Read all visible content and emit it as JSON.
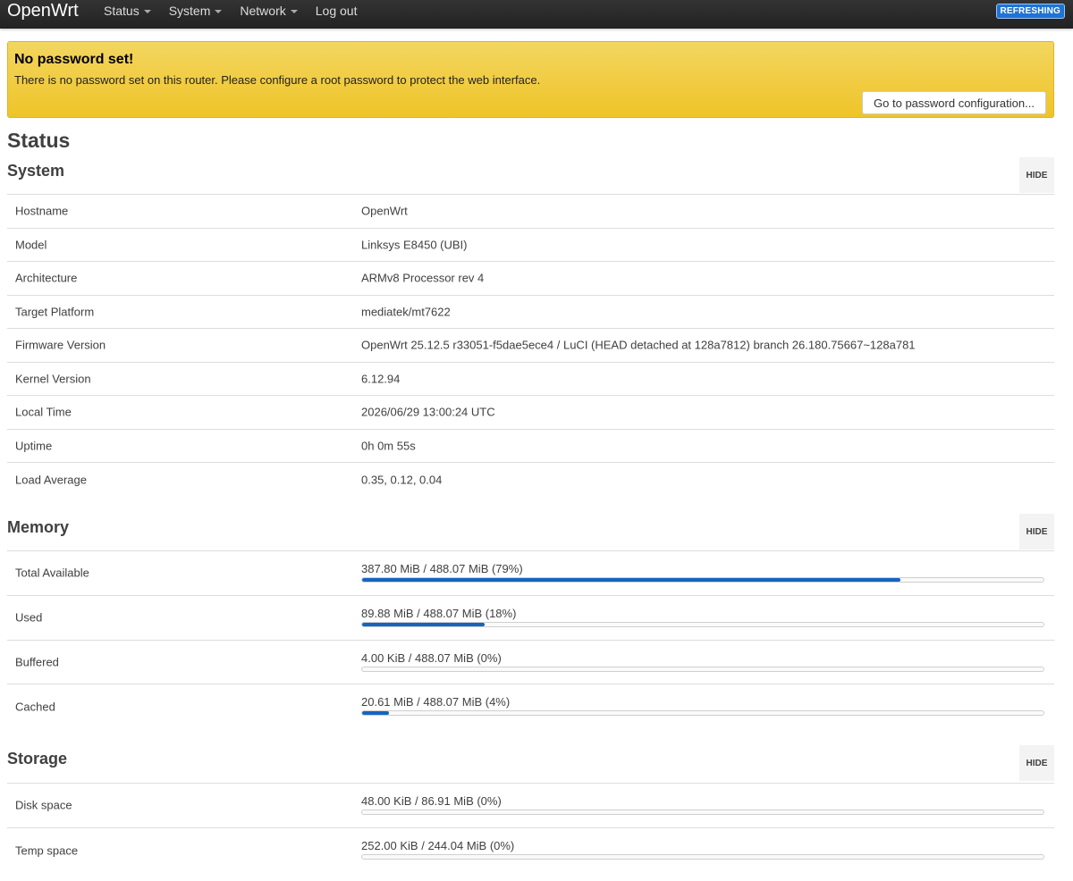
{
  "nav": {
    "brand": "OpenWrt",
    "menus": [
      "Status",
      "System",
      "Network"
    ],
    "logout": "Log out",
    "indicator": "REFRESHING"
  },
  "alert": {
    "title": "No password set!",
    "text": "There is no password set on this router. Please configure a root password to protect the web interface.",
    "button": "Go to password configuration..."
  },
  "page_title": "Status",
  "hide_label": "HIDE",
  "system": {
    "title": "System",
    "rows": [
      {
        "key": "Hostname",
        "value": "OpenWrt"
      },
      {
        "key": "Model",
        "value": "Linksys E8450 (UBI)"
      },
      {
        "key": "Architecture",
        "value": "ARMv8 Processor rev 4"
      },
      {
        "key": "Target Platform",
        "value": "mediatek/mt7622"
      },
      {
        "key": "Firmware Version",
        "value": "OpenWrt 25.12.5 r33051-f5dae5ece4 / LuCI (HEAD detached at 128a7812) branch 26.180.75667~128a781"
      },
      {
        "key": "Kernel Version",
        "value": "6.12.94"
      },
      {
        "key": "Local Time",
        "value": "2026/06/29 13:00:24 UTC"
      },
      {
        "key": "Uptime",
        "value": "0h 0m 55s"
      },
      {
        "key": "Load Average",
        "value": "0.35, 0.12, 0.04"
      }
    ]
  },
  "memory": {
    "title": "Memory",
    "rows": [
      {
        "key": "Total Available",
        "value": "387.80 MiB / 488.07 MiB (79%)",
        "fraction": 0.79
      },
      {
        "key": "Used",
        "value": "89.88 MiB / 488.07 MiB (18%)",
        "fraction": 0.18
      },
      {
        "key": "Buffered",
        "value": "4.00 KiB / 488.07 MiB (0%)",
        "fraction": 0.0
      },
      {
        "key": "Cached",
        "value": "20.61 MiB / 488.07 MiB (4%)",
        "fraction": 0.04
      }
    ]
  },
  "storage": {
    "title": "Storage",
    "rows": [
      {
        "key": "Disk space",
        "value": "48.00 KiB / 86.91 MiB (0%)",
        "fraction": 0.0
      },
      {
        "key": "Temp space",
        "value": "252.00 KiB / 244.04 MiB (0%)",
        "fraction": 0.0
      }
    ]
  },
  "colors": {
    "bar_fill": "#1565c0",
    "alert_bg": "#f0c93a",
    "navbar_bg": "#222222",
    "indicator_bg": "#1e73d6"
  }
}
